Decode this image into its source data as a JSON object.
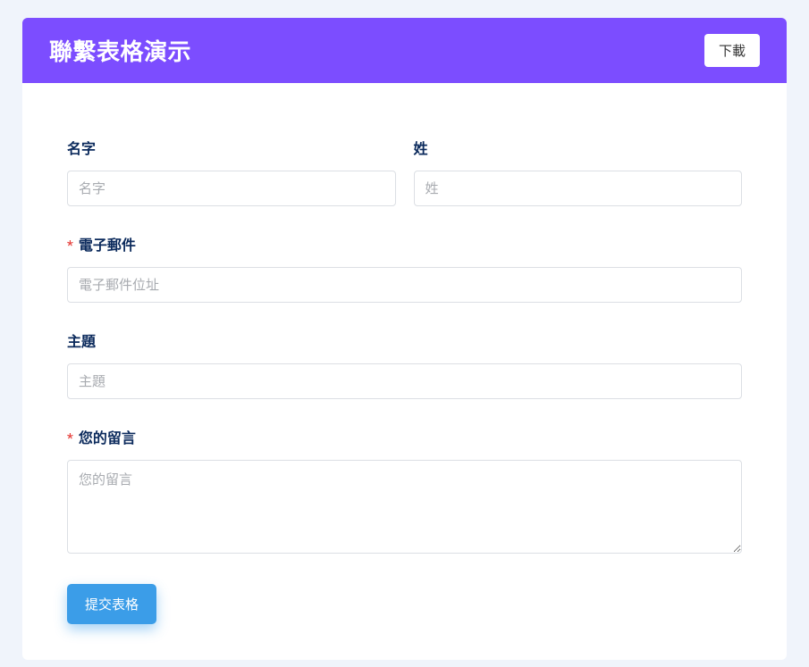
{
  "header": {
    "title": "聯繫表格演示",
    "download_label": "下載"
  },
  "form": {
    "first_name": {
      "label": "名字",
      "placeholder": "名字",
      "value": ""
    },
    "last_name": {
      "label": "姓",
      "placeholder": "姓",
      "value": ""
    },
    "email": {
      "label": "電子郵件",
      "placeholder": "電子郵件位址",
      "value": ""
    },
    "subject": {
      "label": "主題",
      "placeholder": "主題",
      "value": ""
    },
    "message": {
      "label": "您的留言",
      "placeholder": "您的留言",
      "value": ""
    },
    "submit_label": "提交表格",
    "required_star": "*"
  }
}
